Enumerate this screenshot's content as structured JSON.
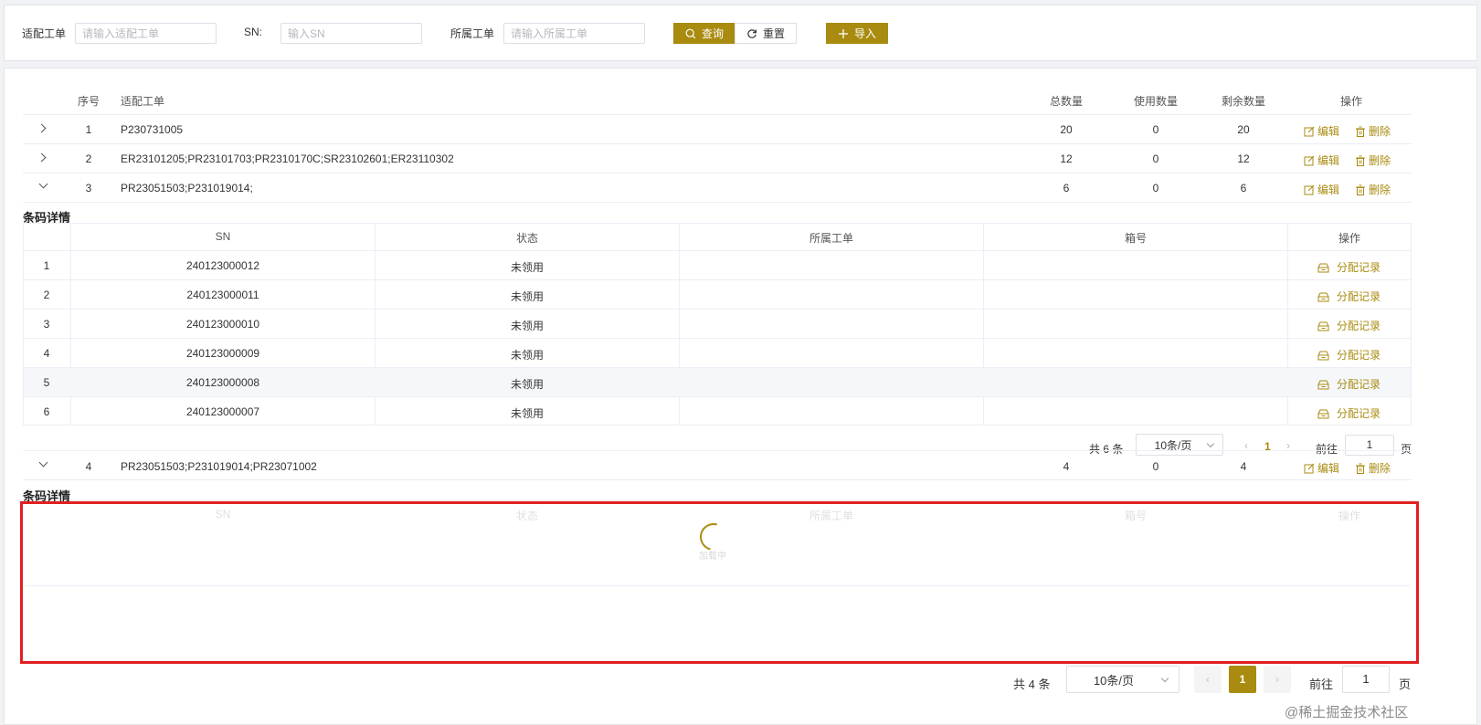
{
  "search": {
    "adapt_order_label": "适配工单",
    "adapt_order_placeholder": "请输入适配工单",
    "sn_label": "SN:",
    "sn_placeholder": "输入SN",
    "belong_order_label": "所属工单",
    "belong_order_placeholder": "请输入所属工单",
    "query_label": "查询",
    "reset_label": "重置",
    "import_label": "导入"
  },
  "table": {
    "headers": {
      "index": "序号",
      "adapt_order": "适配工单",
      "total": "总数量",
      "used": "使用数量",
      "remaining": "剩余数量",
      "ops": "操作"
    },
    "edit_label": "编辑",
    "delete_label": "删除",
    "rows": [
      {
        "index": "1",
        "order": "P230731005",
        "total": "20",
        "used": "0",
        "remaining": "20"
      },
      {
        "index": "2",
        "order": "ER23101205;PR23101703;PR2310170C;SR23102601;ER23110302",
        "total": "12",
        "used": "0",
        "remaining": "12"
      },
      {
        "index": "3",
        "order": "PR23051503;P231019014;",
        "total": "6",
        "used": "0",
        "remaining": "6"
      },
      {
        "index": "4",
        "order": "PR23051503;P231019014;PR23071002",
        "total": "4",
        "used": "0",
        "remaining": "4"
      }
    ]
  },
  "detail": {
    "title": "条码详情",
    "headers": {
      "sn": "SN",
      "status": "状态",
      "belong_order": "所属工单",
      "box": "箱号",
      "ops": "操作"
    },
    "record_label": "分配记录",
    "rows": [
      {
        "index": "1",
        "sn": "240123000012",
        "status": "未领用"
      },
      {
        "index": "2",
        "sn": "240123000011",
        "status": "未领用"
      },
      {
        "index": "3",
        "sn": "240123000010",
        "status": "未领用"
      },
      {
        "index": "4",
        "sn": "240123000009",
        "status": "未领用"
      },
      {
        "index": "5",
        "sn": "240123000008",
        "status": "未领用"
      },
      {
        "index": "6",
        "sn": "240123000007",
        "status": "未领用"
      }
    ],
    "pagination": {
      "total": "共 6 条",
      "page_size": "10条/页",
      "current": "1",
      "goto": "前往",
      "goto_value": "1",
      "page_unit": "页"
    }
  },
  "detail2": {
    "title": "条码详情",
    "loading_text": "加载中"
  },
  "pagination": {
    "total": "共 4 条",
    "page_size": "10条/页",
    "current": "1",
    "goto": "前往",
    "goto_value": "1",
    "page_unit": "页"
  },
  "watermark": "@稀土掘金技术社区",
  "colors": {
    "accent": "#a98b10",
    "highlight": "#e02020"
  }
}
